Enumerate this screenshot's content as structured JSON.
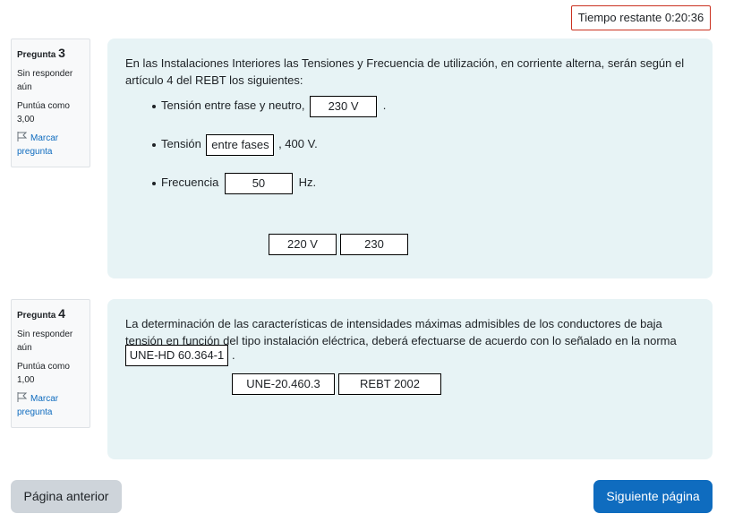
{
  "timer": {
    "text": "Tiempo restante 0:20:36"
  },
  "questions": [
    {
      "label": "Pregunta",
      "number": "3",
      "state": "Sin responder aún",
      "grade": "Puntúa como 3,00",
      "flag": "Marcar pregunta",
      "text": "En las Instalaciones Interiores las Tensiones y Frecuencia de utilización, en corriente alterna,  serán según el artículo 4 del REBT los siguientes:",
      "bullets": [
        {
          "before": "Tensión entre fase y neutro,",
          "drop": "230 V",
          "after": "."
        },
        {
          "before": "Tensión",
          "drop": "entre fases",
          "after": ", 400 V."
        },
        {
          "before": "Frecuencia",
          "drop": "50",
          "after": "Hz."
        }
      ],
      "choices": [
        "220 V",
        "230"
      ]
    },
    {
      "label": "Pregunta",
      "number": "4",
      "state": "Sin responder aún",
      "grade": "Puntúa como 1,00",
      "flag": "Marcar pregunta",
      "text": "La determinación de las características de intensidades máximas admisibles de los conductores de baja tensión en función del tipo instalación eléctrica, deberá efectuarse de acuerdo con lo señalado en la norma",
      "drop": "UNE-HD 60.364-1",
      "after": ".",
      "choices": [
        "UNE-20.460.3",
        "REBT 2002"
      ]
    }
  ],
  "nav": {
    "prev": "Página anterior",
    "next": "Siguiente página"
  },
  "colors": {
    "accent": "#0f6cbf",
    "content_bg": "#e7f3f5",
    "timer_border": "#ca3120"
  }
}
